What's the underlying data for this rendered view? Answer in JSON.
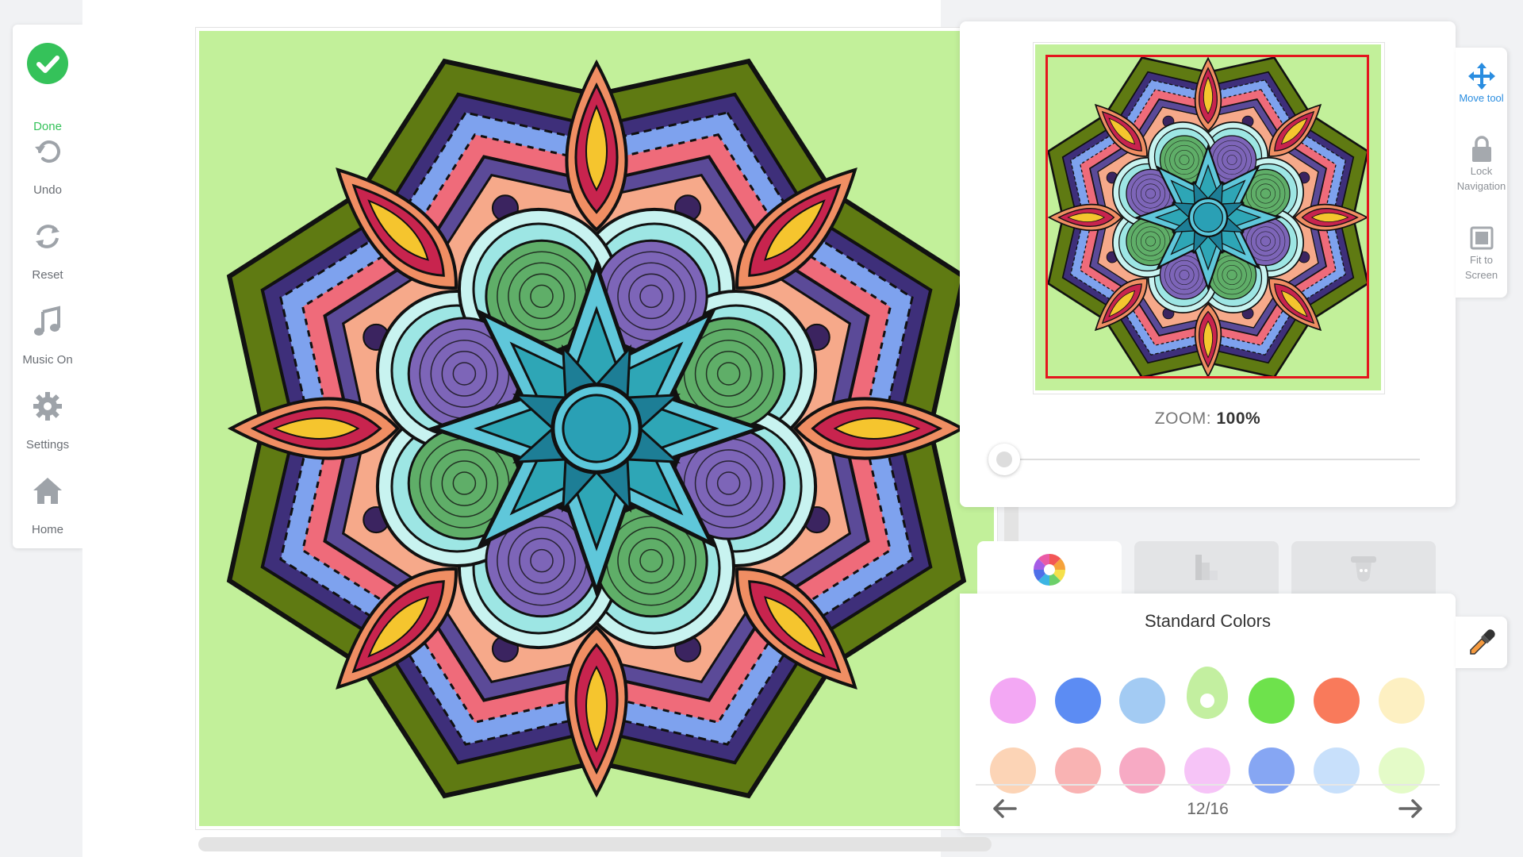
{
  "toolbar": {
    "items": [
      {
        "label": "Done",
        "icon": "check-circle-icon"
      },
      {
        "label": "Undo",
        "icon": "undo-icon"
      },
      {
        "label": "Reset",
        "icon": "reset-icon"
      },
      {
        "label": "Music On",
        "icon": "music-note-icon"
      },
      {
        "label": "Settings",
        "icon": "gear-icon"
      },
      {
        "label": "Home",
        "icon": "home-icon"
      }
    ]
  },
  "artwork": {
    "subject": "mandala",
    "background_color": "#c2f09a"
  },
  "navigator": {
    "zoom_prefix": "ZOOM:",
    "zoom_value": "100%",
    "zoom_level": 0.0
  },
  "side_tools": [
    {
      "label": "Move tool",
      "icon": "move-arrows-icon",
      "active": true
    },
    {
      "label": "Lock Navigation",
      "icon": "lock-icon",
      "active": false
    },
    {
      "label": "Fit to Screen",
      "icon": "fit-screen-icon",
      "active": false
    }
  ],
  "palette": {
    "tabs": [
      {
        "icon": "color-wheel-icon",
        "active": true
      },
      {
        "icon": "gradient-icon",
        "active": false
      },
      {
        "icon": "texture-icon",
        "active": false
      }
    ],
    "title": "Standard Colors",
    "swatches_row1": [
      "#f3a8f4",
      "#5c8cf3",
      "#a3cbf3",
      "#c3efa0",
      "#6ee24c",
      "#f97a5b",
      "#fdf0c2"
    ],
    "swatches_row2": [
      "#fcd4b6",
      "#f9b3b3",
      "#f7aac4",
      "#f6c4f7",
      "#86a6f3",
      "#c8e0fb",
      "#e4fbc8"
    ],
    "selected_index": 3,
    "page_indicator": "12/16"
  },
  "colors": {
    "done_green": "#35c25a",
    "accent_blue": "#2a8de0",
    "viewport_red": "#e4161e"
  }
}
